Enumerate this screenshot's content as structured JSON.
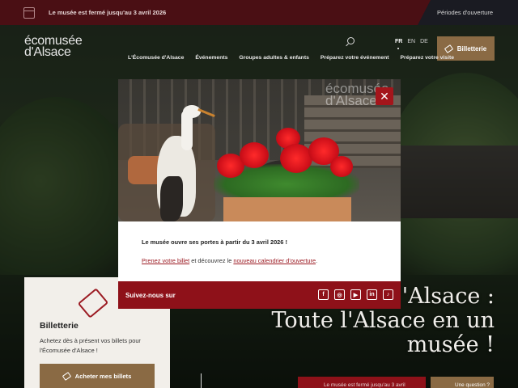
{
  "alert": {
    "message": "Le musée est fermé jusqu'au 3 avril 2026",
    "link_label": "Périodes d'ouverture"
  },
  "header": {
    "logo_line1": "écomusée",
    "logo_line2": "d'Alsace",
    "languages": [
      "FR",
      "EN",
      "DE"
    ],
    "active_language": "FR",
    "ticket_button": "Billetterie",
    "nav": [
      "L'Écomusée d'Alsace",
      "Événements",
      "Groupes adultes & enfants",
      "Préparez votre événement",
      "Préparez votre visite"
    ]
  },
  "popup": {
    "image_logo_line1": "écomusée",
    "image_logo_line2": "d'Alsace",
    "close_symbol": "✕",
    "title": "Le musée ouvre ses portes à partir du 3 avril 2026 !",
    "link1": "Prenez votre billet",
    "text_mid": " et découvrez le ",
    "link2": "nouveau calendrier d'ouverture",
    "text_end": ".",
    "follow_label": "Suivez-nous sur",
    "social": [
      "facebook-icon",
      "instagram-icon",
      "youtube-icon",
      "linkedin-icon",
      "tiktok-icon"
    ]
  },
  "hero": {
    "line1": "'Alsace :",
    "line2": "Toute l'Alsace en un",
    "line3": "musée !"
  },
  "card": {
    "title": "Billetterie",
    "text": "Achetez dès à présent vos billets pour l'Écomusée d'Alsace !",
    "button": "Acheter mes billets"
  },
  "bottom": {
    "red_button": "Le musée est fermé jusqu'au 3 avril",
    "gold_button": "Une question ?"
  },
  "colors": {
    "brand_red": "#8e1119",
    "brand_gold": "#8a6a44",
    "alert_red": "#4a0f14"
  }
}
